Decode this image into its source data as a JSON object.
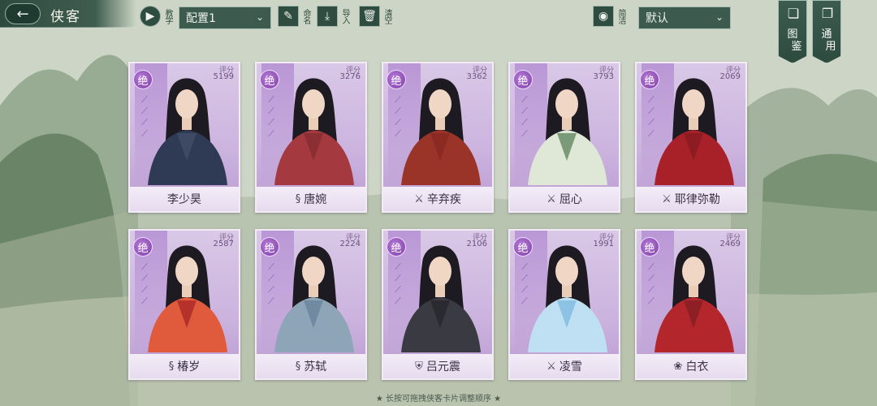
{
  "header": {
    "title": "侠客",
    "back_glyph": "←",
    "tutorial_label": "教学",
    "config_select": "配置1",
    "rename_label": "命名",
    "import_label": "导入",
    "clear_label": "清空",
    "simple_label": "简洁",
    "sort_select": "默认",
    "codex_tab": [
      "图",
      "鉴"
    ],
    "general_tab": [
      "通",
      "用"
    ]
  },
  "cards": [
    {
      "rank": "绝",
      "score_label": "评分",
      "score": "5199",
      "name": "李少昊",
      "sect_icon": "",
      "accent": "#3e4a63",
      "robe": "#2f3b55"
    },
    {
      "rank": "绝",
      "score_label": "评分",
      "score": "3276",
      "name": "唐婉",
      "sect_icon": "swirl-icon",
      "accent": "#8b2f35",
      "robe": "#a43a3f"
    },
    {
      "rank": "绝",
      "score_label": "评分",
      "score": "3362",
      "name": "辛弃疾",
      "sect_icon": "sword-icon",
      "accent": "#8a2a22",
      "robe": "#9a3428"
    },
    {
      "rank": "绝",
      "score_label": "评分",
      "score": "3793",
      "name": "屈心",
      "sect_icon": "sword-icon",
      "accent": "#7b9a78",
      "robe": "#dfe8d6"
    },
    {
      "rank": "绝",
      "score_label": "评分",
      "score": "2069",
      "name": "耶律弥勒",
      "sect_icon": "sword-icon",
      "accent": "#8c1c22",
      "robe": "#a82129"
    },
    {
      "rank": "绝",
      "score_label": "评分",
      "score": "2587",
      "name": "椿岁",
      "sect_icon": "swirl-icon",
      "accent": "#b5322c",
      "robe": "#e05a3c"
    },
    {
      "rank": "绝",
      "score_label": "评分",
      "score": "2224",
      "name": "苏轼",
      "sect_icon": "swirl-icon",
      "accent": "#6f8aa1",
      "robe": "#8ea5b8"
    },
    {
      "rank": "绝",
      "score_label": "评分",
      "score": "2106",
      "name": "吕元震",
      "sect_icon": "shield-icon",
      "accent": "#2a2a30",
      "robe": "#3a3a42"
    },
    {
      "rank": "绝",
      "score_label": "评分",
      "score": "1991",
      "name": "凌雪",
      "sect_icon": "sword-icon",
      "accent": "#8cc2e3",
      "robe": "#bfe0f2"
    },
    {
      "rank": "绝",
      "score_label": "评分",
      "score": "2469",
      "name": "白衣",
      "sect_icon": "lotus-icon",
      "accent": "#8e1f24",
      "robe": "#b3262b"
    }
  ],
  "footer_hint": "★ 长按可拖拽侠客卡片调整顺序 ★"
}
